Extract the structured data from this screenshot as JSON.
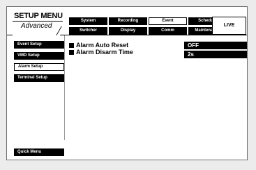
{
  "title": {
    "main": "SETUP MENU",
    "sub": "Advanced"
  },
  "tabs": [
    {
      "label": "System",
      "active": false
    },
    {
      "label": "Recording",
      "active": false
    },
    {
      "label": "Event",
      "active": true
    },
    {
      "label": "Schedule",
      "active": false
    },
    {
      "label": "Switcher",
      "active": false
    },
    {
      "label": "Display",
      "active": false
    },
    {
      "label": "Comm",
      "active": false
    },
    {
      "label": "Maintenance",
      "active": false
    }
  ],
  "live_label": "LIVE",
  "sidebar": {
    "items": [
      {
        "label": "Event Setup",
        "active": false
      },
      {
        "label": "VMD Setup",
        "active": false
      },
      {
        "label": "Alarm Setup",
        "active": true
      },
      {
        "label": "Terminal Setup",
        "active": false
      }
    ],
    "quick_menu": "Quick Menu"
  },
  "settings": [
    {
      "label": "Alarm Auto Reset",
      "value": "OFF"
    },
    {
      "label": "Alarm Disarm Time",
      "value": "2s"
    }
  ]
}
